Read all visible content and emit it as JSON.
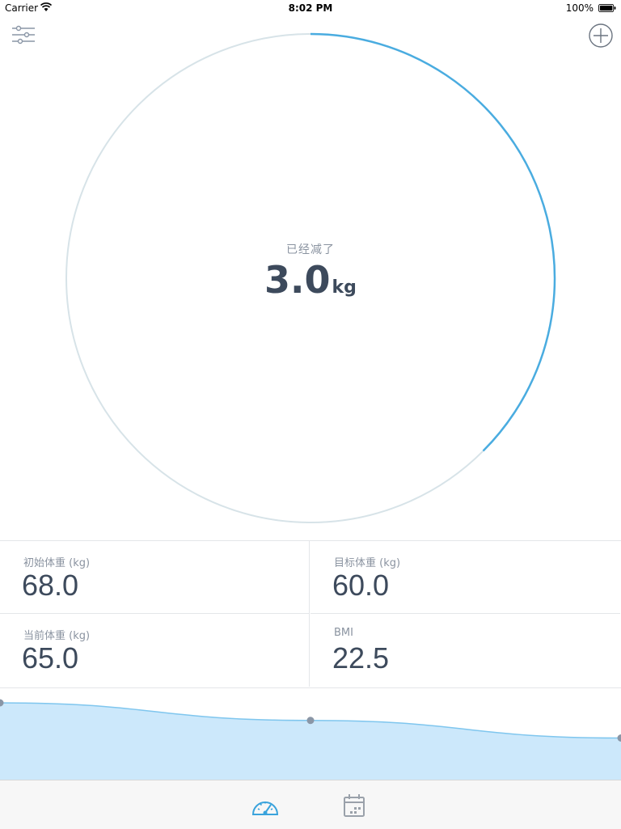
{
  "status_bar": {
    "carrier": "Carrier",
    "time": "8:02 PM",
    "battery": "100%"
  },
  "toolbar": {
    "left_icon": "filter-sliders-icon",
    "right_icon": "plus-circle-icon"
  },
  "progress_ring": {
    "label": "已经减了",
    "value": "3.0",
    "unit": "kg",
    "progress_fraction": 0.375,
    "track_color": "#d7e3e8",
    "progress_color": "#4aace0"
  },
  "stats": [
    {
      "label": "初始体重 (kg)",
      "value": "68.0"
    },
    {
      "label": "目标体重 (kg)",
      "value": "60.0"
    },
    {
      "label": "当前体重 (kg)",
      "value": "65.0"
    },
    {
      "label": "BMI",
      "value": "22.5"
    }
  ],
  "trend_chart": {
    "weights": [
      68.0,
      66.5,
      65.0
    ],
    "fill_color": "#cce8fb",
    "line_color": "#7fc6ee",
    "point_color": "#8a96a6"
  },
  "tab_bar": {
    "tabs": [
      {
        "icon": "speedometer-icon",
        "active": true
      },
      {
        "icon": "calendar-icon",
        "active": false
      }
    ],
    "active_color": "#3aa3dc",
    "inactive_color": "#9aa1aa"
  }
}
